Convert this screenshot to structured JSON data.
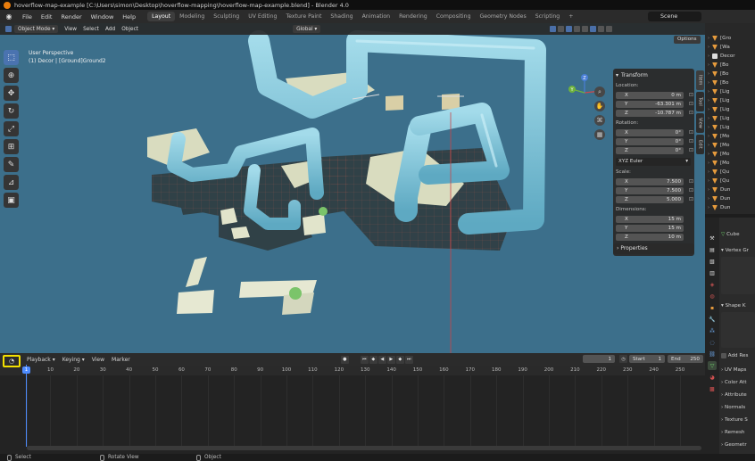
{
  "window": {
    "title": "hoverflow-map-example [C:\\Users\\simon\\Desktop\\hoverflow-mapping\\hoverflow-map-example.blend] - Blender 4.0"
  },
  "menu": [
    "File",
    "Edit",
    "Render",
    "Window",
    "Help"
  ],
  "workspaces": [
    "Layout",
    "Modeling",
    "Sculpting",
    "UV Editing",
    "Texture Paint",
    "Shading",
    "Animation",
    "Rendering",
    "Compositing",
    "Geometry Nodes",
    "Scripting"
  ],
  "active_workspace": "Layout",
  "add_workspace": "+",
  "scene": {
    "label": "Scene"
  },
  "viewport": {
    "mode": "Object Mode",
    "menus": [
      "View",
      "Select",
      "Add",
      "Object"
    ],
    "orientation": "Global",
    "options_label": "Options",
    "perspective": "User Perspective",
    "context": "(1) Decor | [Ground]Ground2",
    "gizmo": {
      "x": "X",
      "y": "Y",
      "z": "Z"
    }
  },
  "npanel": {
    "section": "Transform",
    "location_label": "Location:",
    "location": [
      {
        "axis": "X",
        "value": "0 m"
      },
      {
        "axis": "Y",
        "value": "-63.301 m"
      },
      {
        "axis": "Z",
        "value": "-10.787 m"
      }
    ],
    "rotation_label": "Rotation:",
    "rotation": [
      {
        "axis": "X",
        "value": "0°"
      },
      {
        "axis": "Y",
        "value": "0°"
      },
      {
        "axis": "Z",
        "value": "0°"
      }
    ],
    "rotation_mode": "XYZ Euler",
    "scale_label": "Scale:",
    "scale": [
      {
        "axis": "X",
        "value": "7.500"
      },
      {
        "axis": "Y",
        "value": "7.500"
      },
      {
        "axis": "Z",
        "value": "5.000"
      }
    ],
    "dimensions_label": "Dimensions:",
    "dimensions": [
      {
        "axis": "X",
        "value": "15 m"
      },
      {
        "axis": "Y",
        "value": "15 m"
      },
      {
        "axis": "Z",
        "value": "10 m"
      }
    ],
    "properties_label": "Properties",
    "tabs": [
      "Item",
      "Tool",
      "View",
      "Edit"
    ]
  },
  "outliner": {
    "rows": [
      "[Gro",
      "[Wa",
      "Decor",
      "[Bo",
      "[Bo",
      "[Bo",
      "[Lig",
      "[Lig",
      "[Lig",
      "[Lig",
      "[Lig",
      "[Mo",
      "[Mo",
      "[Mo",
      "[Mo",
      "[Qu",
      "[Qu",
      "Dun",
      "Dun",
      "Dun"
    ]
  },
  "properties": {
    "object_name": "Cube",
    "panels": [
      "Vertex Gr",
      "Shape K",
      "Add Res",
      "UV Maps",
      "Color Att",
      "Attribute",
      "Normals",
      "Texture S",
      "Remesh",
      "Geometr"
    ]
  },
  "timeline": {
    "menus": [
      "Playback",
      "Keying",
      "View",
      "Marker"
    ],
    "current_frame": "1",
    "start_label": "Start",
    "start_value": "1",
    "end_label": "End",
    "end_value": "250",
    "ticks": [
      "1",
      "10",
      "20",
      "30",
      "40",
      "50",
      "60",
      "70",
      "80",
      "90",
      "100",
      "110",
      "120",
      "130",
      "140",
      "150",
      "160",
      "170",
      "180",
      "190",
      "200",
      "210",
      "220",
      "230",
      "240",
      "250"
    ],
    "playhead_label": "1"
  },
  "statusbar": {
    "items": [
      "Select",
      "Rotate View",
      "Object"
    ]
  },
  "colors": {
    "viewport_bg": "#3c6f8b",
    "pipe": "#7fc7dc",
    "ground_tile": "#d9dcbf",
    "highlight": "#f3e000",
    "accent": "#4a73b0"
  }
}
